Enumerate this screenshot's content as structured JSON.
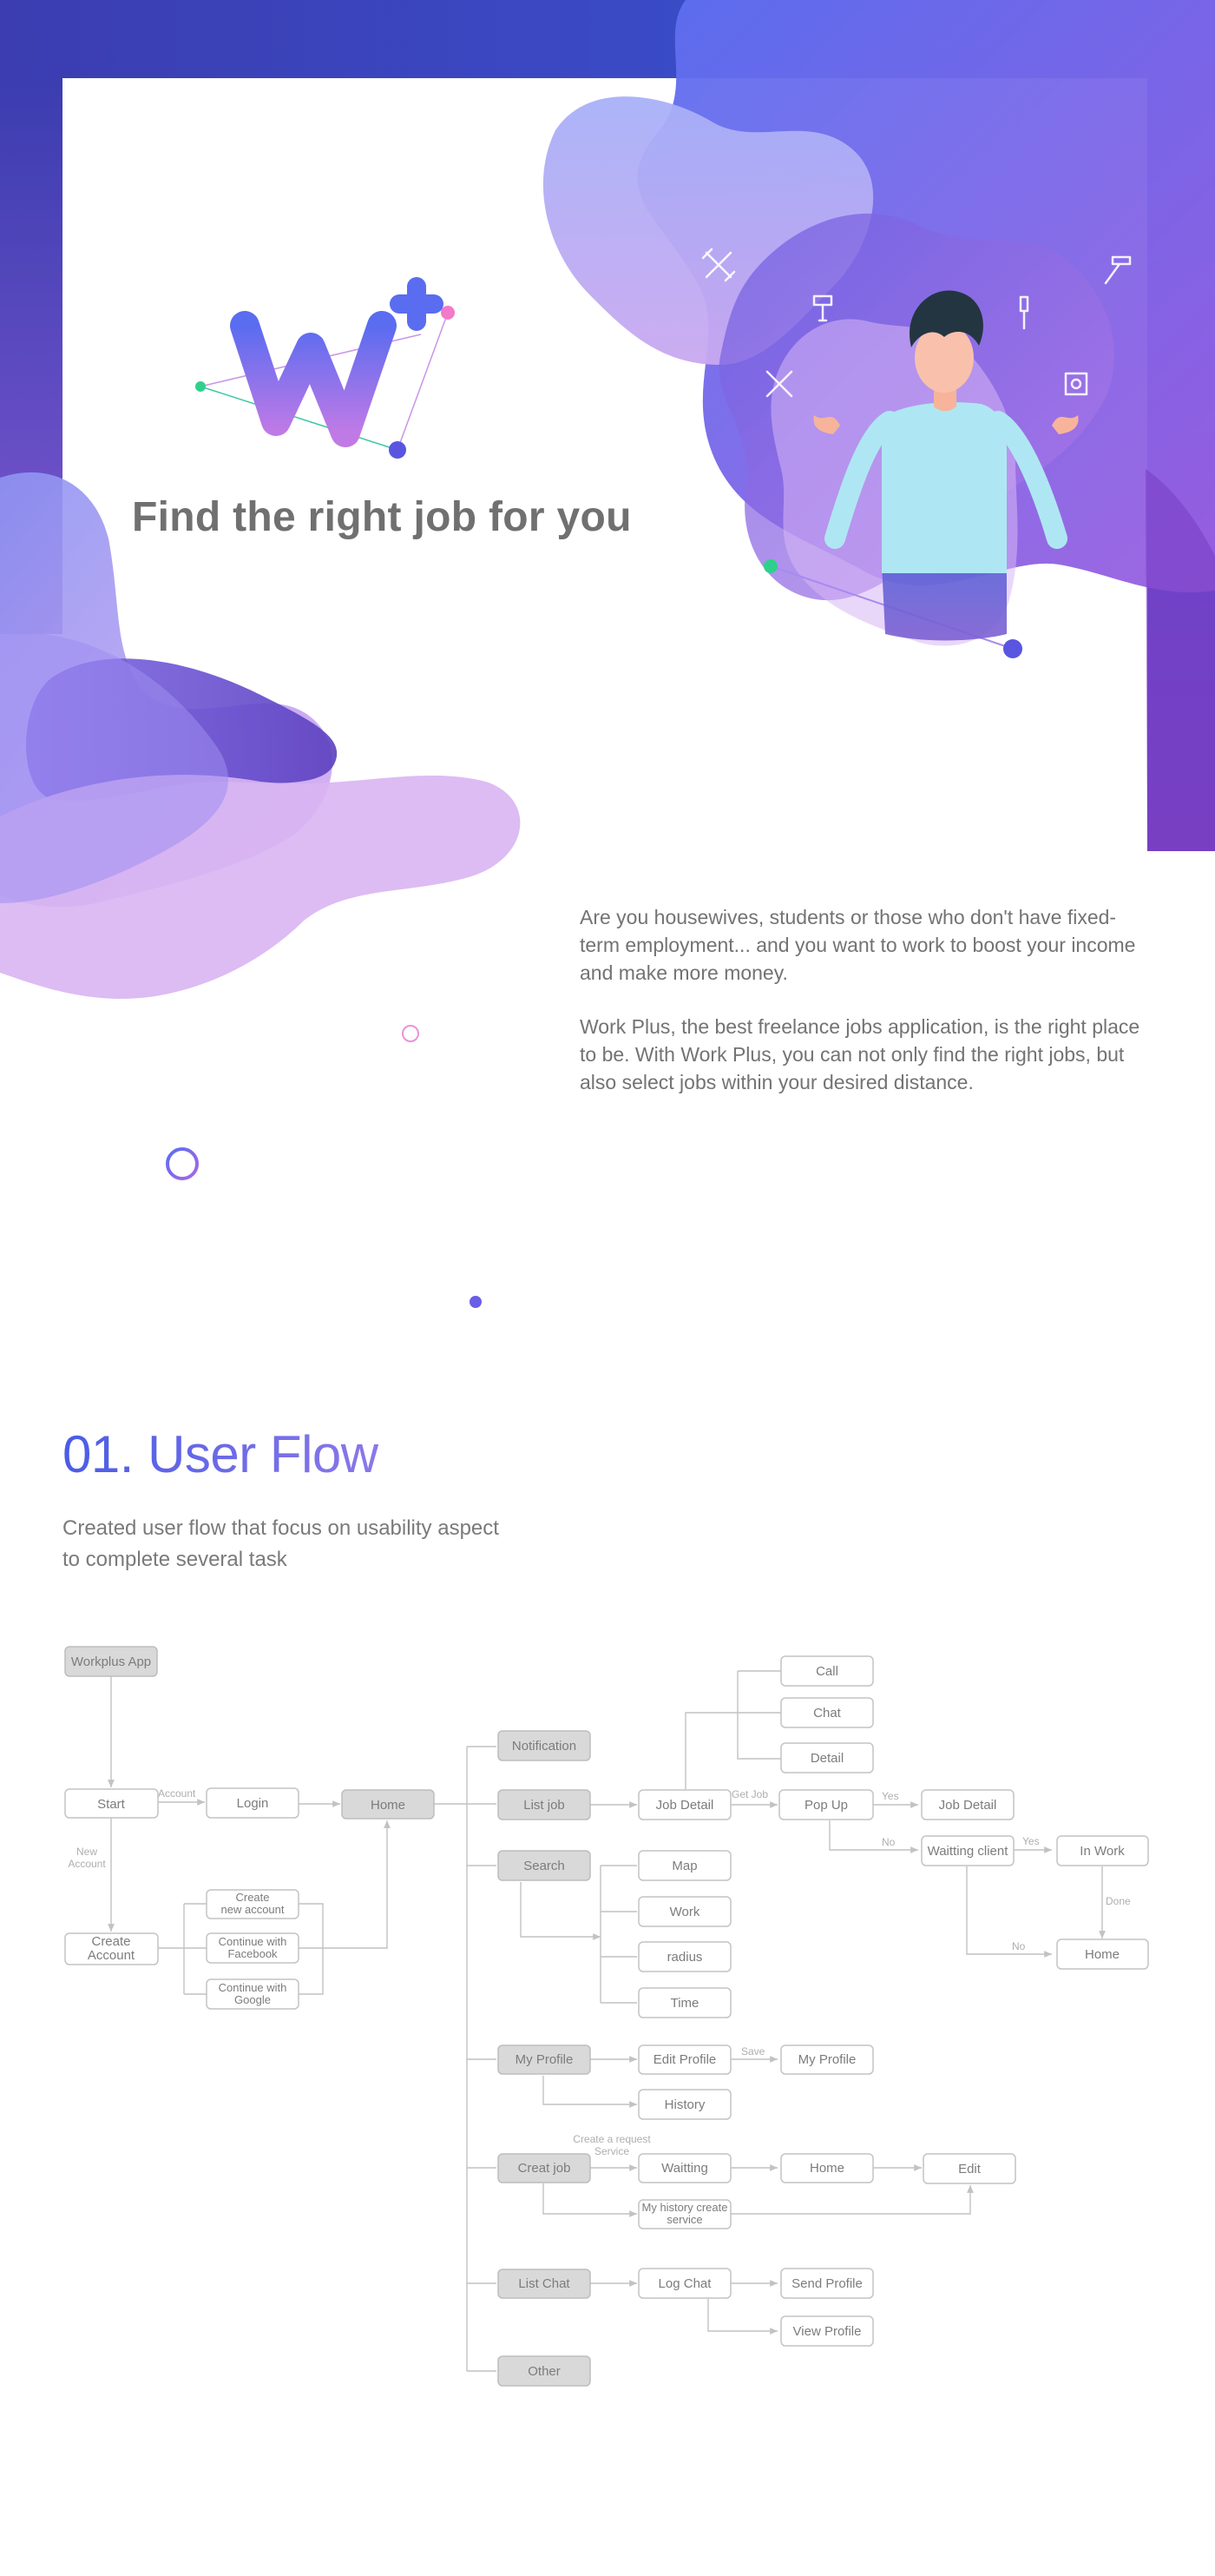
{
  "hero": {
    "title": "Find the right job for you"
  },
  "intro": {
    "paragraph_1": "Are you housewives, students or those who don't have fixed-term employment... and you want to work to boost your income and make more money.",
    "paragraph_2": "Work Plus, the best freelance jobs application, is the right place to be. With Work Plus, you can not only find the right jobs, but also select jobs within your desired distance."
  },
  "section": {
    "title": "01. User Flow",
    "subtitle": "Created user flow that focus on usability aspect to complete several task"
  },
  "flow": {
    "nodes": {
      "workplus_app": "Workplus App",
      "start": "Start",
      "login": "Login",
      "home": "Home",
      "create_account": [
        "Create",
        "Account"
      ],
      "create_new_account": [
        "Create",
        "new account"
      ],
      "continue_facebook": [
        "Continue with",
        "Facebook"
      ],
      "continue_google": [
        "Continue with",
        "Google"
      ],
      "notification": "Notification",
      "list_job": "List job",
      "search": "Search",
      "my_profile": "My Profile",
      "creat_job": "Creat job",
      "list_chat": "List Chat",
      "other": "Other",
      "job_detail": "Job Detail",
      "call": "Call",
      "chat": "Chat",
      "detail": "Detail",
      "pop_up": "Pop Up",
      "job_detail_2": "Job Detail",
      "waitting_client": "Waitting client",
      "in_work": "In Work",
      "home_2": "Home",
      "map": "Map",
      "work": "Work",
      "radius": "radius",
      "time": "Time",
      "edit_profile": "Edit Profile",
      "my_profile_2": "My Profile",
      "history": "History",
      "waitting": "Waitting",
      "home_3": "Home",
      "edit": "Edit",
      "my_history_create_service": [
        "My history create",
        "service"
      ],
      "log_chat": "Log Chat",
      "send_profile": "Send Profile",
      "view_profile": "View Profile"
    },
    "edge_labels": {
      "account": "Account",
      "new_account": [
        "New",
        "Account"
      ],
      "get_job": "Get Job",
      "yes_1": "Yes",
      "no_1": "No",
      "yes_2": "Yes",
      "done": "Done",
      "no_2": "No",
      "save": "Save",
      "create_request": [
        "Create a request",
        "Service"
      ]
    }
  },
  "colors": {
    "brand_blue": "#4a5ce6",
    "brand_purple": "#8b5bd6",
    "accent_pink": "#f27ac9",
    "accent_green": "#2fd08c",
    "node_grey": "#d9d9d9"
  },
  "icons": [
    "logo-w-plus",
    "wrench-icon",
    "screwdriver-icon",
    "hammer-icon",
    "plug-icon",
    "tools-icon",
    "paint-roller-icon",
    "tape-measure-icon"
  ]
}
